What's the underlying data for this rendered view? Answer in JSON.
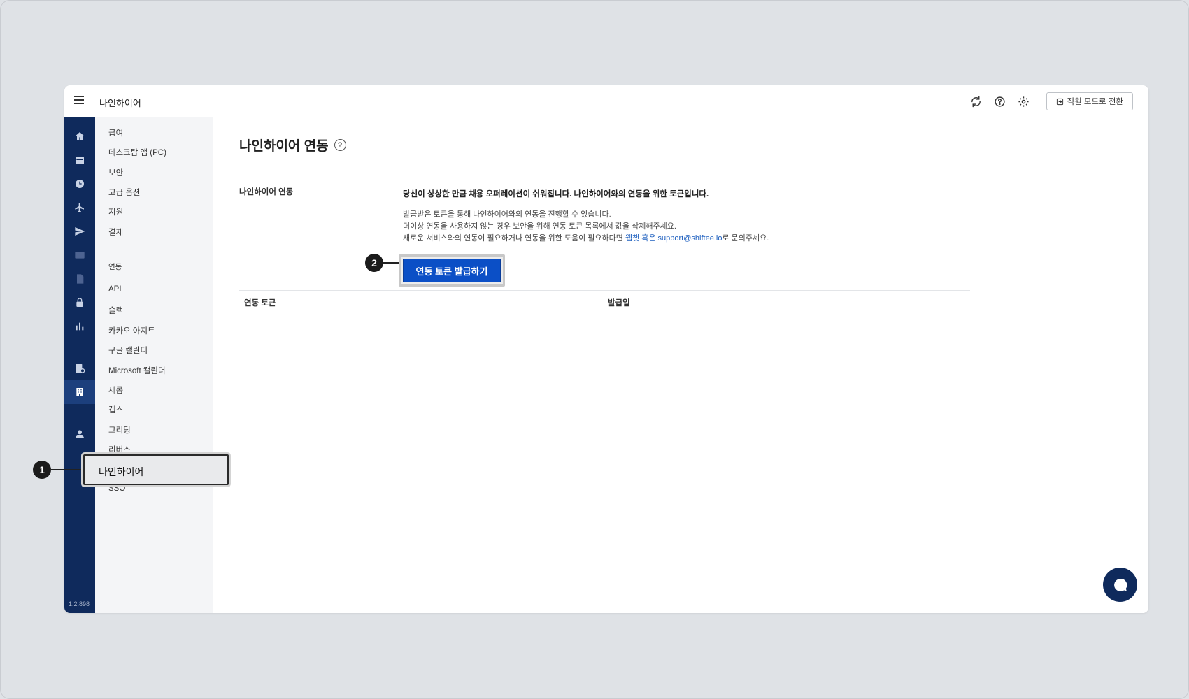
{
  "topbar": {
    "app_title": "나인하이어",
    "mode_button_label": "직원 모드로 전환",
    "icons": [
      "refresh-icon",
      "help-icon",
      "gear-icon",
      "switch-icon"
    ]
  },
  "rail": {
    "icons": [
      "home-icon",
      "calendar-icon",
      "clock-icon",
      "plane-icon",
      "send-icon",
      "card-icon",
      "document-icon",
      "lock-icon",
      "chart-icon",
      "report-icon",
      "building-icon",
      "user-icon"
    ],
    "version": "1.2.898"
  },
  "submenu": {
    "items_top": [
      "급여",
      "데스크탑 앱 (PC)",
      "보안",
      "고급 옵션",
      "지원",
      "결제"
    ],
    "section_label": "연동",
    "items_integration": [
      "API",
      "슬랙",
      "카카오 아지트",
      "구글 캘린더",
      "Microsoft 캘린더",
      "세콤",
      "캡스",
      "그리팅",
      "리버스"
    ],
    "highlighted_item": "나인하이어",
    "items_after": [
      "SSO"
    ]
  },
  "main": {
    "title": "나인하이어 연동",
    "section_label": "나인하이어 연동",
    "headline": "당신이 상상한 만큼 채용 오퍼레이션이 쉬워집니다. 나인하이어와의 연동을 위한 토큰입니다.",
    "line1": "발급받은 토큰을 통해 나인하이어와의 연동을 진행할 수 있습니다.",
    "line2": "더이상 연동을 사용하지 않는 경우 보안을 위해 연동 토큰 목록에서 값을 삭제해주세요.",
    "line3_prefix": "새로운 서비스와의 연동이 필요하거나 연동을 위한 도움이 필요하다면 ",
    "line3_link1": "웹챗",
    "line3_or": " 혹은 ",
    "line3_link2": "support@shiftee.io",
    "line3_suffix": "로 문의주세요.",
    "issue_button_label": "연동 토큰 발급하기",
    "table_headers": [
      "연동 토큰",
      "발급일"
    ]
  },
  "callouts": [
    "1",
    "2"
  ]
}
